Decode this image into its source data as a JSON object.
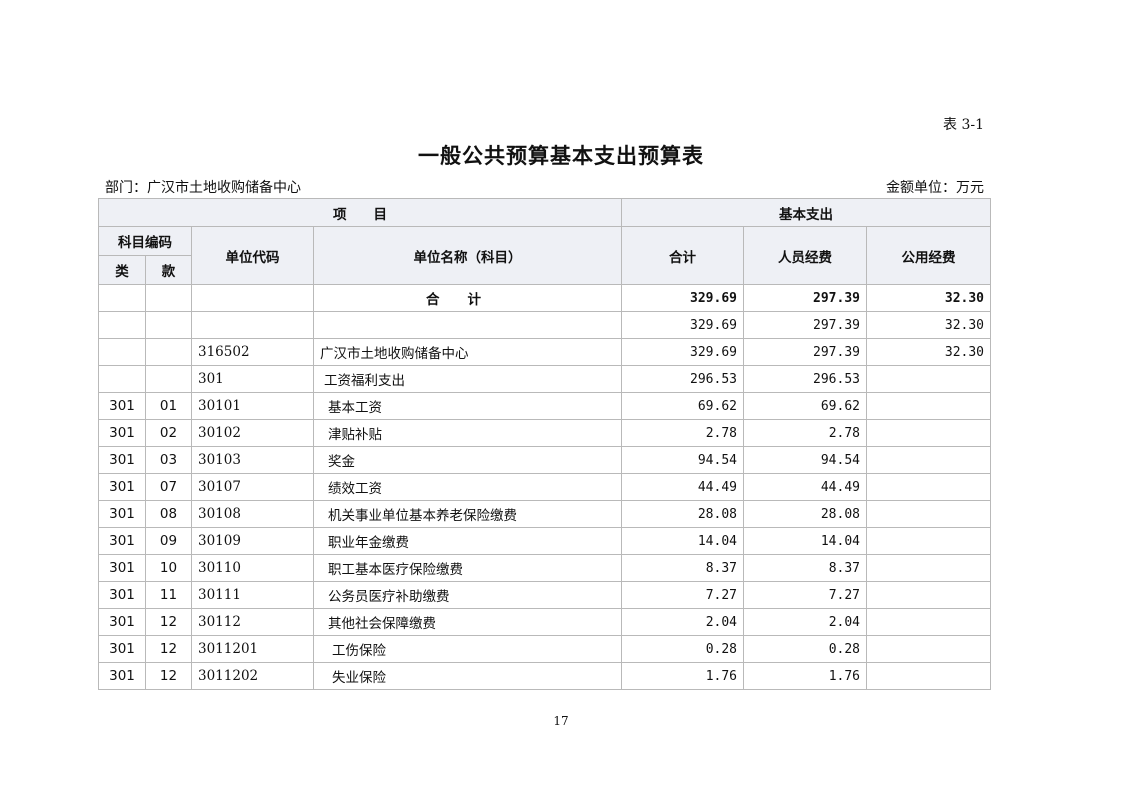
{
  "header": {
    "table_no": "表 3-1",
    "title": "一般公共预算基本支出预算表",
    "dept": "部门：广汉市土地收购储备中心",
    "unit": "金额单位：万元"
  },
  "columns": {
    "project": "项　　目",
    "basic_exp": "基本支出",
    "subject_code": "科目编码",
    "unit_code": "单位代码",
    "unit_name": "单位名称（科目）",
    "total": "合计",
    "personnel": "人员经费",
    "public": "公用经费",
    "lei": "类",
    "kuan": "款"
  },
  "rows": [
    {
      "lei": "",
      "kuan": "",
      "code": "",
      "name": "合计",
      "total": "329.69",
      "personnel": "297.39",
      "public": "32.30"
    },
    {
      "lei": "",
      "kuan": "",
      "code": "",
      "name": "",
      "total": "329.69",
      "personnel": "297.39",
      "public": "32.30"
    },
    {
      "lei": "",
      "kuan": "",
      "code": "316502",
      "name": "广汉市土地收购储备中心",
      "total": "329.69",
      "personnel": "297.39",
      "public": "32.30"
    },
    {
      "lei": "",
      "kuan": "",
      "code": "301",
      "name": "工资福利支出",
      "total": "296.53",
      "personnel": "296.53",
      "public": ""
    },
    {
      "lei": "301",
      "kuan": "01",
      "code": "30101",
      "name": "基本工资",
      "total": "69.62",
      "personnel": "69.62",
      "public": ""
    },
    {
      "lei": "301",
      "kuan": "02",
      "code": "30102",
      "name": "津贴补贴",
      "total": "2.78",
      "personnel": "2.78",
      "public": ""
    },
    {
      "lei": "301",
      "kuan": "03",
      "code": "30103",
      "name": "奖金",
      "total": "94.54",
      "personnel": "94.54",
      "public": ""
    },
    {
      "lei": "301",
      "kuan": "07",
      "code": "30107",
      "name": "绩效工资",
      "total": "44.49",
      "personnel": "44.49",
      "public": ""
    },
    {
      "lei": "301",
      "kuan": "08",
      "code": "30108",
      "name": "机关事业单位基本养老保险缴费",
      "total": "28.08",
      "personnel": "28.08",
      "public": ""
    },
    {
      "lei": "301",
      "kuan": "09",
      "code": "30109",
      "name": "职业年金缴费",
      "total": "14.04",
      "personnel": "14.04",
      "public": ""
    },
    {
      "lei": "301",
      "kuan": "10",
      "code": "30110",
      "name": "职工基本医疗保险缴费",
      "total": "8.37",
      "personnel": "8.37",
      "public": ""
    },
    {
      "lei": "301",
      "kuan": "11",
      "code": "30111",
      "name": "公务员医疗补助缴费",
      "total": "7.27",
      "personnel": "7.27",
      "public": ""
    },
    {
      "lei": "301",
      "kuan": "12",
      "code": "30112",
      "name": "其他社会保障缴费",
      "total": "2.04",
      "personnel": "2.04",
      "public": ""
    },
    {
      "lei": "301",
      "kuan": "12",
      "code": "3011201",
      "name": "工伤保险",
      "total": "0.28",
      "personnel": "0.28",
      "public": ""
    },
    {
      "lei": "301",
      "kuan": "12",
      "code": "3011202",
      "name": "失业保险",
      "total": "1.76",
      "personnel": "1.76",
      "public": ""
    }
  ],
  "footer": {
    "page_no": "17"
  }
}
